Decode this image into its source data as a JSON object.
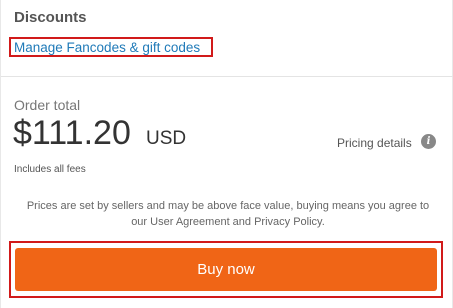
{
  "discounts": {
    "title": "Discounts",
    "manage_link": "Manage Fancodes & gift codes"
  },
  "order": {
    "total_label": "Order total",
    "amount": "$111.20",
    "currency": "USD",
    "fees_note": "Includes all fees",
    "pricing_details": "Pricing details",
    "info_icon": "i"
  },
  "disclaimer": "Prices are set by sellers and may be above face value, buying means you agree to our User Agreement and Privacy Policy.",
  "buy_button": "Buy now",
  "colors": {
    "accent": "#f06516",
    "link": "#1f7ab8",
    "highlight": "#d11a1a"
  },
  "icons": {
    "info": "info-icon"
  }
}
